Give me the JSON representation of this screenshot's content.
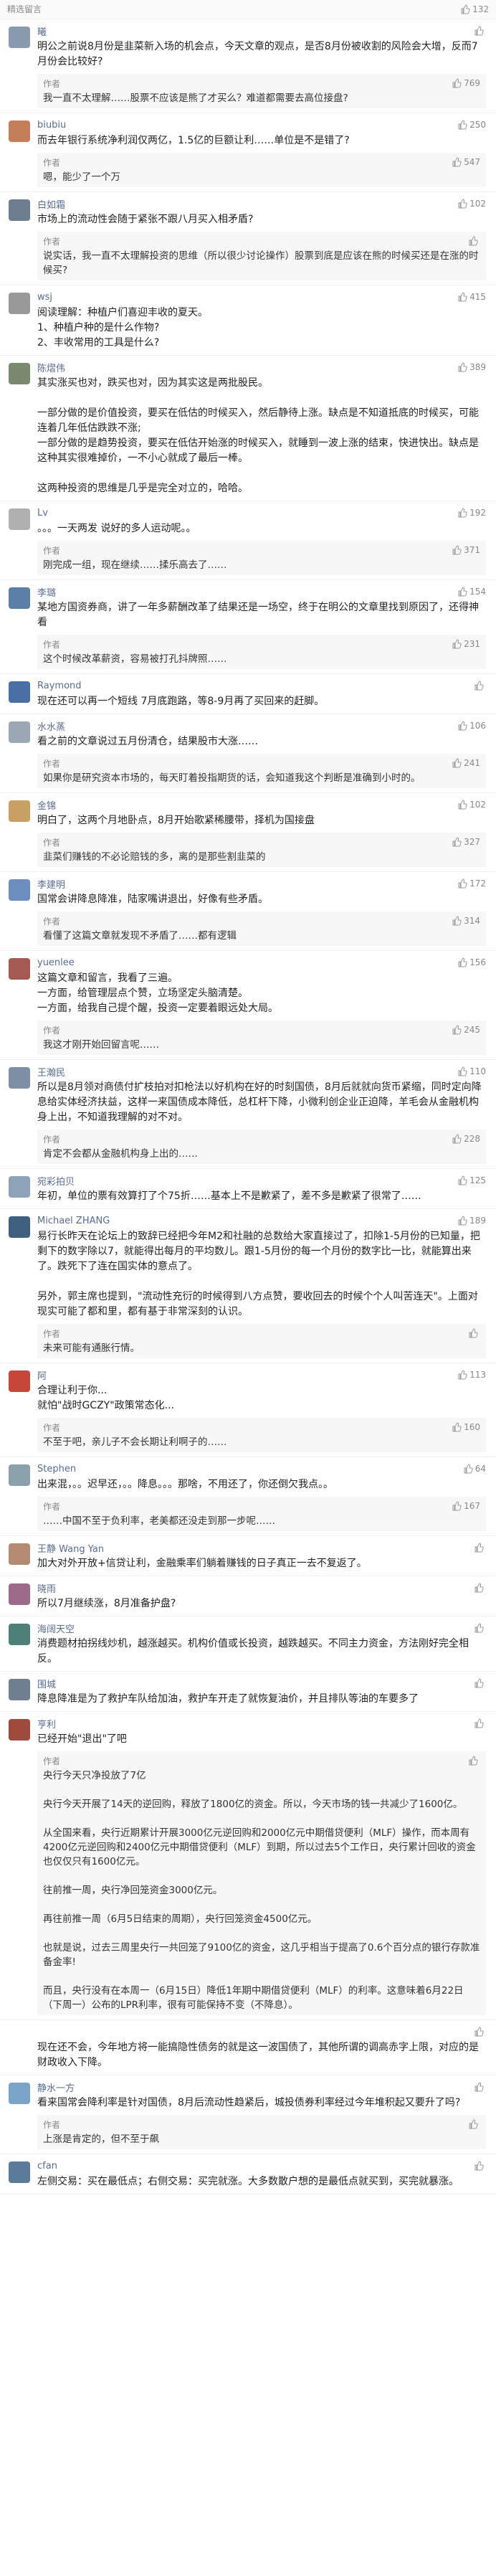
{
  "header": {
    "title": "精选留言",
    "like_count": "132"
  },
  "comments": [
    {
      "name": "曦",
      "avatar_color": "#8a9bb0",
      "likes": "",
      "text": "明公之前说8月份是韭菜新入场的机会点，今天文章的观点，是否8月份被收割的风险会大增，反而7月份会比较好?",
      "reply": "我一直不太理解……股票不应该是熊了才买么？难道都需要去高位接盘?",
      "reply_likes": "769"
    },
    {
      "name": "biubiu",
      "avatar_color": "#c47f5a",
      "likes": "250",
      "text": "而去年银行系统净利润仅两亿，1.5亿的巨额让利……单位是不是错了?",
      "reply": "嗯，能少了一个万",
      "reply_likes": "547"
    },
    {
      "name": "白如霜",
      "avatar_color": "#6d7c8f",
      "likes": "102",
      "text": "市场上的流动性会随于紧张不跟八月买入相矛盾?",
      "reply": "说实话，我一直不太理解投资的思维（所以很少讨论操作）股票到底是应该在熊的时候买还是在涨的时候买?",
      "reply_likes": ""
    },
    {
      "name": "wsj",
      "avatar_color": "#999999",
      "likes": "415",
      "text": "阅读理解：种植户们喜迎丰收的夏天。\n1、种植户种的是什么作物?\n2、丰收常用的工具是什么?",
      "reply": "",
      "reply_likes": ""
    },
    {
      "name": "陈熠伟",
      "avatar_color": "#7b8a6e",
      "likes": "389",
      "text": "其实涨买也对，跌买也对，因为其实这是两批股民。\n\n一部分做的是价值投资，要买在低估的时候买入，然后静待上涨。缺点是不知道抵底的时候买，可能连着几年低估跌跌不涨;\n一部分做的是趋势投资，要买在低估开始涨的时候买入，就睡到一波上涨的结束，快进快出。缺点是这种其实很难掉价，一不小心就成了最后一棒。\n\n这两种投资的思维是几乎是完全对立的，哈哈。",
      "reply": "",
      "reply_likes": ""
    },
    {
      "name": "Lv",
      "avatar_color": "#b0b0b0",
      "likes": "192",
      "text": "。。。一天两发 说好的多人运动呢。。",
      "reply": "刚完成一组，现在继续……揉乐高去了……",
      "reply_likes": "371"
    },
    {
      "name": "李璐",
      "avatar_color": "#5b7fa6",
      "likes": "154",
      "text": "某地方国资券商，讲了一年多薪酬改革了结果还是一场空，终于在明公的文章里找到原因了，还得神看",
      "reply": "这个时候改革薪资，容易被打孔抖牌照……",
      "reply_likes": "231"
    },
    {
      "name": "Raymond",
      "avatar_color": "#4a6fa5",
      "likes": "",
      "text": "现在还可以再一个短线 7月底跑路，等8-9月再了买回来的赶脚。",
      "reply": "",
      "reply_likes": ""
    },
    {
      "name": "水水蒸",
      "avatar_color": "#9aa7b5",
      "likes": "106",
      "text": "看之前的文章说过五月份清仓，结果股市大涨……",
      "reply": "如果你是研究资本市场的，每天盯着投指期货的话，会知道我这个判断是准确到小时的。",
      "reply_likes": "241"
    },
    {
      "name": "金锦",
      "avatar_color": "#c9a063",
      "likes": "102",
      "text": "明白了，这两个月地卧点，8月开始歌紧稀腰带，择机为国接盘",
      "reply": "韭菜们赚钱的不必论赔钱的多，离的是那些割韭菜的",
      "reply_likes": "327"
    },
    {
      "name": "李建明",
      "avatar_color": "#6c8ebf",
      "likes": "172",
      "text": "国常会讲降息降准，陆家嘴讲退出，好像有些矛盾。",
      "reply": "看懂了这篇文章就发现不矛盾了……都有逻辑",
      "reply_likes": "314"
    },
    {
      "name": "yuenlee",
      "avatar_color": "#a45a52",
      "likes": "156",
      "text": "这篇文章和留言，我看了三遍。\n一方面，给管理层点个赞，立场坚定头脑清楚。\n一方面，给我自己提个醒，投资一定要着眼远处大局。",
      "reply": "我这才刚开始回留言呢……",
      "reply_likes": "245"
    },
    {
      "name": "王瀚民",
      "avatar_color": "#7f8fa6",
      "likes": "110",
      "text": "所以是8月领对商债付扩枝拍对扣枪法以好机构在好的时刻国债，8月后就就向货币紧缩，同时定向降息给实体经济扶益，这样一来国债成本降低，总杠杆下降，小微利创企业正迫降，羊毛会从金融机构身上出，不知道我理解的对不对。",
      "reply": "肯定不会都从金融机构身上出的……",
      "reply_likes": "228"
    },
    {
      "name": "宛彩拍贝",
      "avatar_color": "#8fa3b8",
      "likes": "125",
      "text": "年初，单位的票有效算打了个75折……基本上不是歉紧了，差不多是歉紧了很常了……",
      "reply": "",
      "reply_likes": ""
    },
    {
      "name": "Michael ZHANG",
      "avatar_color": "#3e5f7d",
      "likes": "189",
      "text": "易行长昨天在论坛上的致辞已经把今年M2和社融的总数给大家直接过了，扣除1-5月份的已知量，把剩下的数字除以7，就能得出每月的平均数儿。跟1-5月份的每一个月份的数字比一比，就能算出来了。跌死下了连在国实体的意点了。\n\n另外，郭主席也提到，\"流动性充衍的时候得到八方点赞，要收回去的时候个个人叫苦连天\"。上面对现实可能了都和里，都有基于非常深刻的认识。",
      "reply": "未来可能有通胀行情。",
      "reply_likes": ""
    },
    {
      "name": "阿",
      "avatar_color": "#c4473a",
      "likes": "113",
      "text": "合理让利于你...\n就怕\"战时GCZY\"政策常态化...",
      "reply": "不至于吧，亲儿子不会长期让利啊子的……",
      "reply_likes": "160"
    },
    {
      "name": "Stephen",
      "avatar_color": "#8aa0ab",
      "likes": "64",
      "text": "出来混，。。迟早还，。。降息。。。那啥，不用还了，你还倒欠我点。。",
      "reply": "……中国不至于负利率，老美都还没走到那一步呢……",
      "reply_likes": "167"
    },
    {
      "name": "王静 Wang Yan",
      "avatar_color": "#b28b72",
      "likes": "",
      "text": "加大对外开放+信贷让利，金融乘率们躺着赚钱的日子真正一去不复返了。",
      "reply": "",
      "reply_likes": ""
    },
    {
      "name": "晓雨",
      "avatar_color": "#9c6b8b",
      "likes": "",
      "text": "所以7月继续涨，8月准备护盘?",
      "reply": "",
      "reply_likes": ""
    },
    {
      "name": "海阔天空",
      "avatar_color": "#4d8077",
      "likes": "",
      "text": "消费题材拍拐线炒机，越涨越买。机构价值或长投资，越跌越买。不同主力资金，方法刚好完全相反。",
      "reply": "",
      "reply_likes": ""
    },
    {
      "name": "围城",
      "avatar_color": "#6f7f8f",
      "likes": "",
      "text": "降息降准是为了救护车队给加油，救护车开走了就恢复油价，并且排队等油的车要多了",
      "reply": "",
      "reply_likes": ""
    },
    {
      "name": "亨利",
      "avatar_color": "#a04a3d",
      "likes": "",
      "text": "已经开始\"退出\"了吧",
      "reply": "央行今天只净投放了7亿\n\n央行今天开展了14天的逆回购，释放了1800亿的资金。所以，今天市场的钱一共减少了1600亿。\n\n从全国来看，央行近期累计开展3000亿元逆回购和2000亿元中期借贷便利（MLF）操作，而本周有4200亿元逆回购和2400亿元中期借贷便利（MLF）到期，所以过去5个工作日，央行累计回收的资金也仅仅只有1600亿元。\n\n往前推一周，央行净回笼资金3000亿元。\n\n再往前推一周（6月5日结束的周期），央行回笼资金4500亿元。\n\n也就是说，过去三周里央行一共回笼了9100亿的资金，这几乎相当于提高了0.6个百分点的银行存款准备金率!\n\n而且，央行没有在本周一（6月15日）降低1年期中期借贷便利（MLF）的利率。这意味着6月22日（下周一）公布的LPR利率，很有可能保持不变（不降息）。",
      "reply_likes": ""
    },
    {
      "name": "",
      "avatar_color": "#ffffff",
      "likes": "",
      "text": "现在还不会，今年地方将一能搞隐性债务的就是这一波国债了，其他所谓的调高赤字上限，对应的是财政收入下降。",
      "reply": "",
      "reply_likes": ""
    },
    {
      "name": "静水一方",
      "avatar_color": "#7aa3c8",
      "likes": "",
      "text": "看来国常会降利率是针对国债，8月后流动性趋紧后，城投债券利率经过今年堆积起又要升了吗?",
      "reply": "上涨是肯定的，但不至于飙",
      "reply_likes": ""
    },
    {
      "name": "cfan",
      "avatar_color": "#5c7a99",
      "likes": "",
      "text": "左侧交易：买在最低点；右侧交易：买完就涨。大多数散户想的是最低点就买到，买完就暴涨。",
      "reply": "",
      "reply_likes": ""
    }
  ]
}
